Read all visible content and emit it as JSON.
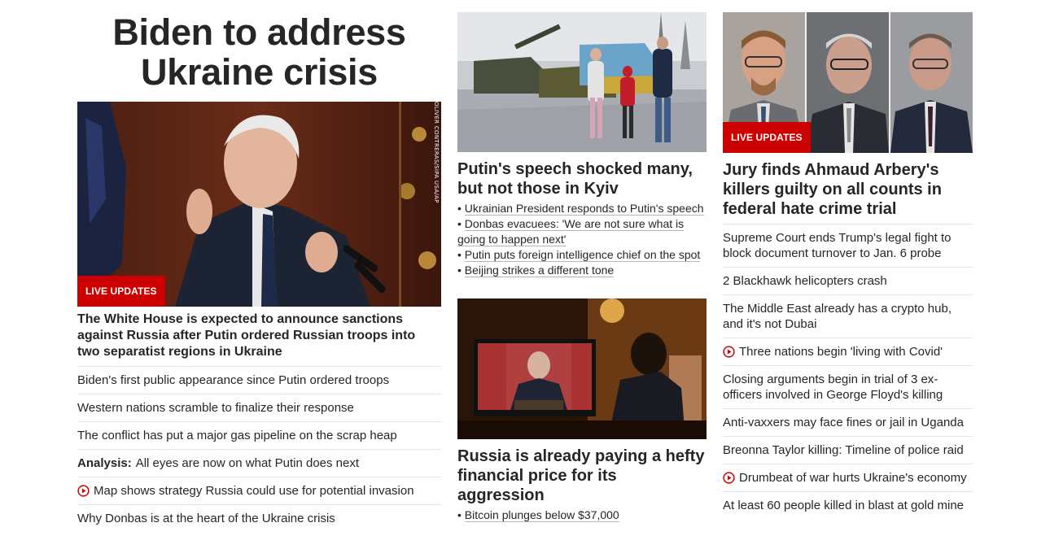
{
  "column1": {
    "banner_title_line1": "Biden to address",
    "banner_title_line2": "Ukraine crisis",
    "hero_badge": "LIVE UPDATES",
    "photo_credit": "OLIVER CONTRERAS/SIPA USA/AP",
    "lead_headline": "The White House is expected to announce sanctions against Russia after Putin ordered Russian troops into two separatist regions in Ukraine",
    "links": [
      {
        "text": "Biden's first public appearance since Putin ordered troops"
      },
      {
        "text": "Western nations scramble to finalize their response"
      },
      {
        "text": "The conflict has put a major gas pipeline on the scrap heap"
      },
      {
        "bold": "Analysis:",
        "text": "All eyes are now on what Putin does next"
      },
      {
        "text": "Map shows strategy Russia could use for potential invasion",
        "icon": "play-icon"
      },
      {
        "text": "Why Donbas is at the heart of the Ukraine crisis"
      }
    ]
  },
  "column2": {
    "story1": {
      "headline": "Putin's speech shocked many, but not those in Kyiv",
      "bullets": [
        "Ukrainian President responds to Putin's speech",
        "Donbas evacuees: 'We are not sure what is going to happen next'",
        "Putin puts foreign intelligence chief on the spot",
        "Beijing strikes a different tone"
      ]
    },
    "story2": {
      "headline": "Russia is already paying a hefty financial price for its aggression",
      "bullets": [
        "Bitcoin plunges below $37,000"
      ]
    }
  },
  "column3": {
    "image_badge": "LIVE UPDATES",
    "headline": "Jury finds Ahmaud Arbery's killers guilty on all counts in federal hate crime trial",
    "links": [
      {
        "text": "Supreme Court ends Trump's legal fight to block document turnover to Jan. 6 probe"
      },
      {
        "text": "2 Blackhawk helicopters crash"
      },
      {
        "text": "The Middle East already has a crypto hub, and it's not Dubai"
      },
      {
        "text": "Three nations begin 'living with Covid'",
        "icon": "play-icon"
      },
      {
        "text": "Closing arguments begin in trial of 3 ex-officers involved in George Floyd's killing"
      },
      {
        "text": "Anti-vaxxers may face fines or jail in Uganda"
      },
      {
        "text": "Breonna Taylor killing: Timeline of police raid"
      },
      {
        "text": "Drumbeat of war hurts Ukraine's economy",
        "icon": "play-icon"
      },
      {
        "text": "At least 60 people killed in blast at gold mine"
      }
    ]
  },
  "colors": {
    "accent_red": "#cc0000",
    "text": "#262626",
    "divider": "#e6e6e6"
  }
}
